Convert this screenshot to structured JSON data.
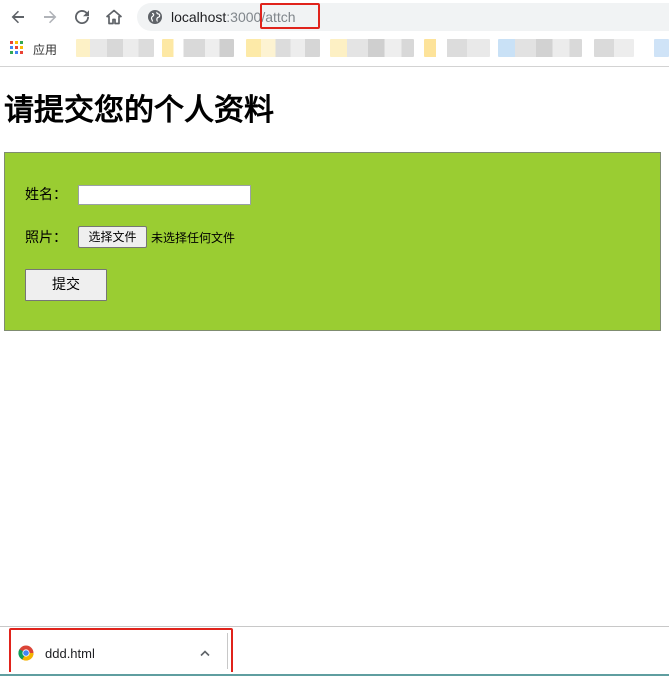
{
  "browser": {
    "address_bar": {
      "host": "localhost",
      "port": ":3000",
      "path": "/attch"
    },
    "bookmarks_bar": {
      "apps_label": "应用"
    },
    "icons": [
      "back-arrow-icon",
      "forward-arrow-icon",
      "reload-icon",
      "home-icon",
      "globe-icon",
      "apps-grid-icon"
    ]
  },
  "page": {
    "title": "请提交您的个人资料",
    "form": {
      "name_label": "姓名：",
      "name_value": "",
      "photo_label": "照片：",
      "file_button_label": "选择文件",
      "file_status": "未选择任何文件",
      "submit_label": "提交",
      "background_color": "#9acd32"
    }
  },
  "download_shelf": {
    "file_name": "ddd.html",
    "icons": [
      "chrome-icon",
      "chevron-up-icon"
    ]
  },
  "colors": {
    "highlight_border": "#e0231b"
  }
}
